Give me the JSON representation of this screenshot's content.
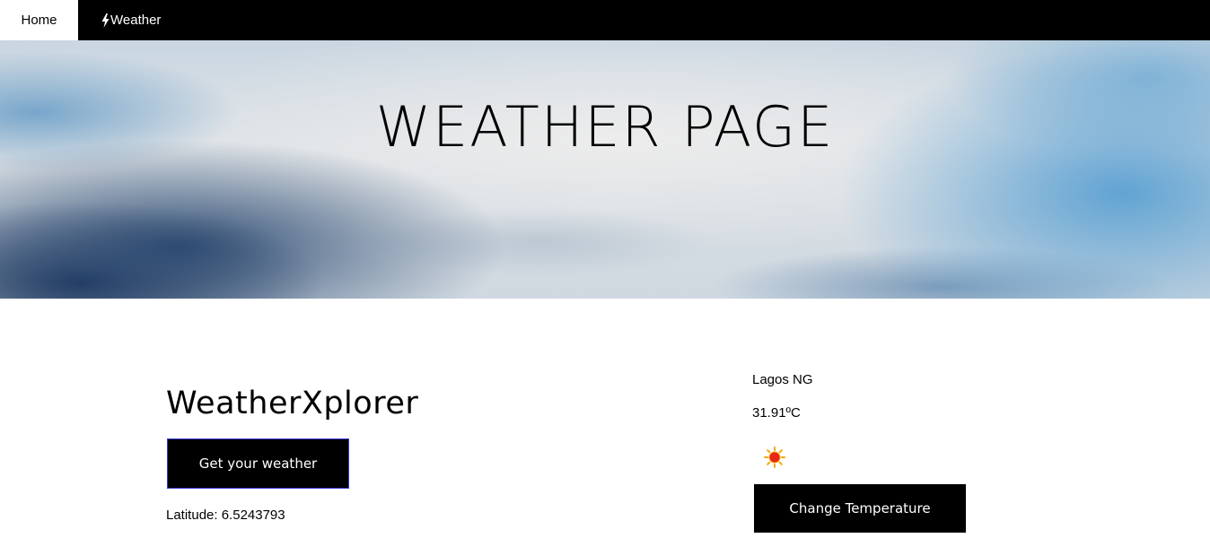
{
  "nav": {
    "home_label": "Home",
    "weather_label": "Weather",
    "weather_icon": "lightning-bolt-icon"
  },
  "hero": {
    "title": "WEATHER PAGE"
  },
  "main": {
    "app_title": "WeatherXplorer",
    "get_weather_label": "Get your weather",
    "latitude_text": "Latitude: 6.5243793"
  },
  "weather": {
    "location": "Lagos NG",
    "temperature": "31.91ºC",
    "condition_icon": "sun-icon",
    "change_temp_label": "Change Temperature"
  },
  "colors": {
    "nav_bg": "#000000",
    "button_bg": "#000000",
    "button_border_accent": "#3b3bdb",
    "sun_core": "#e8261a",
    "sun_rays": "#f2a900"
  }
}
